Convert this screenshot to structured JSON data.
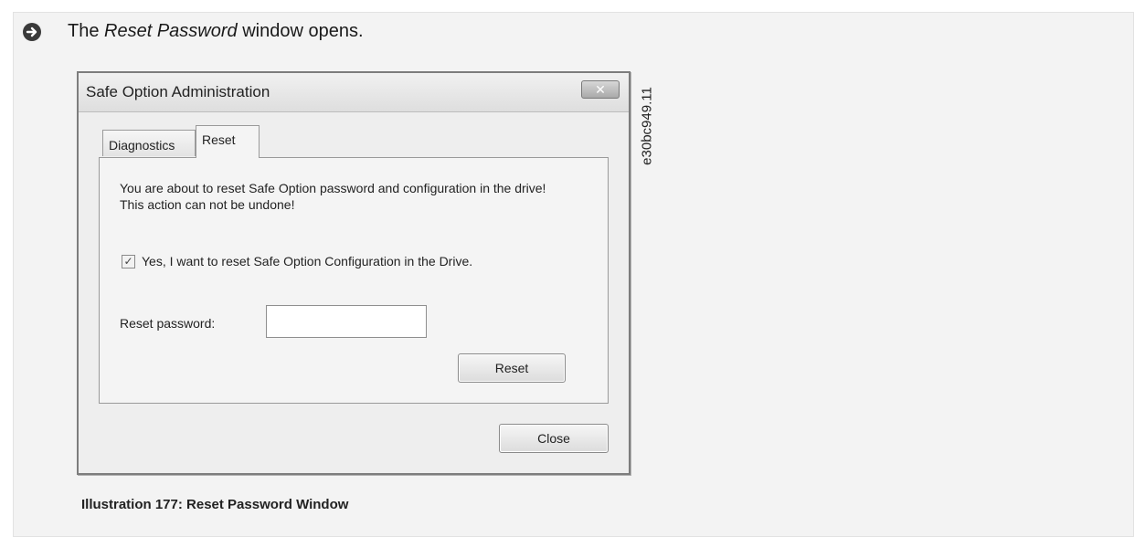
{
  "result": {
    "prefix": "The ",
    "emphasis": "Reset Password",
    "suffix": " window opens."
  },
  "figure_code": "e30bc949.11",
  "window": {
    "title": "Safe Option Administration",
    "close_glyph": "✕",
    "tabs": [
      {
        "label": "Diagnostics"
      },
      {
        "label": "Reset",
        "active": true
      }
    ],
    "warning_text": "You are about to reset Safe Option password and configuration in the drive! This action can not be undone!",
    "confirm_checkbox": {
      "checked": true,
      "mark": "✓",
      "label": "Yes, I want to reset Safe Option Configuration in the Drive."
    },
    "password": {
      "label": "Reset password:",
      "value": ""
    },
    "reset_button": "Reset",
    "close_button": "Close"
  },
  "caption": "Illustration 177: Reset Password Window",
  "icons": {
    "result": "arrow-right-circle-icon"
  },
  "colors": {
    "panel_bg": "#f3f3f3",
    "icon": "#3a3a3a"
  }
}
